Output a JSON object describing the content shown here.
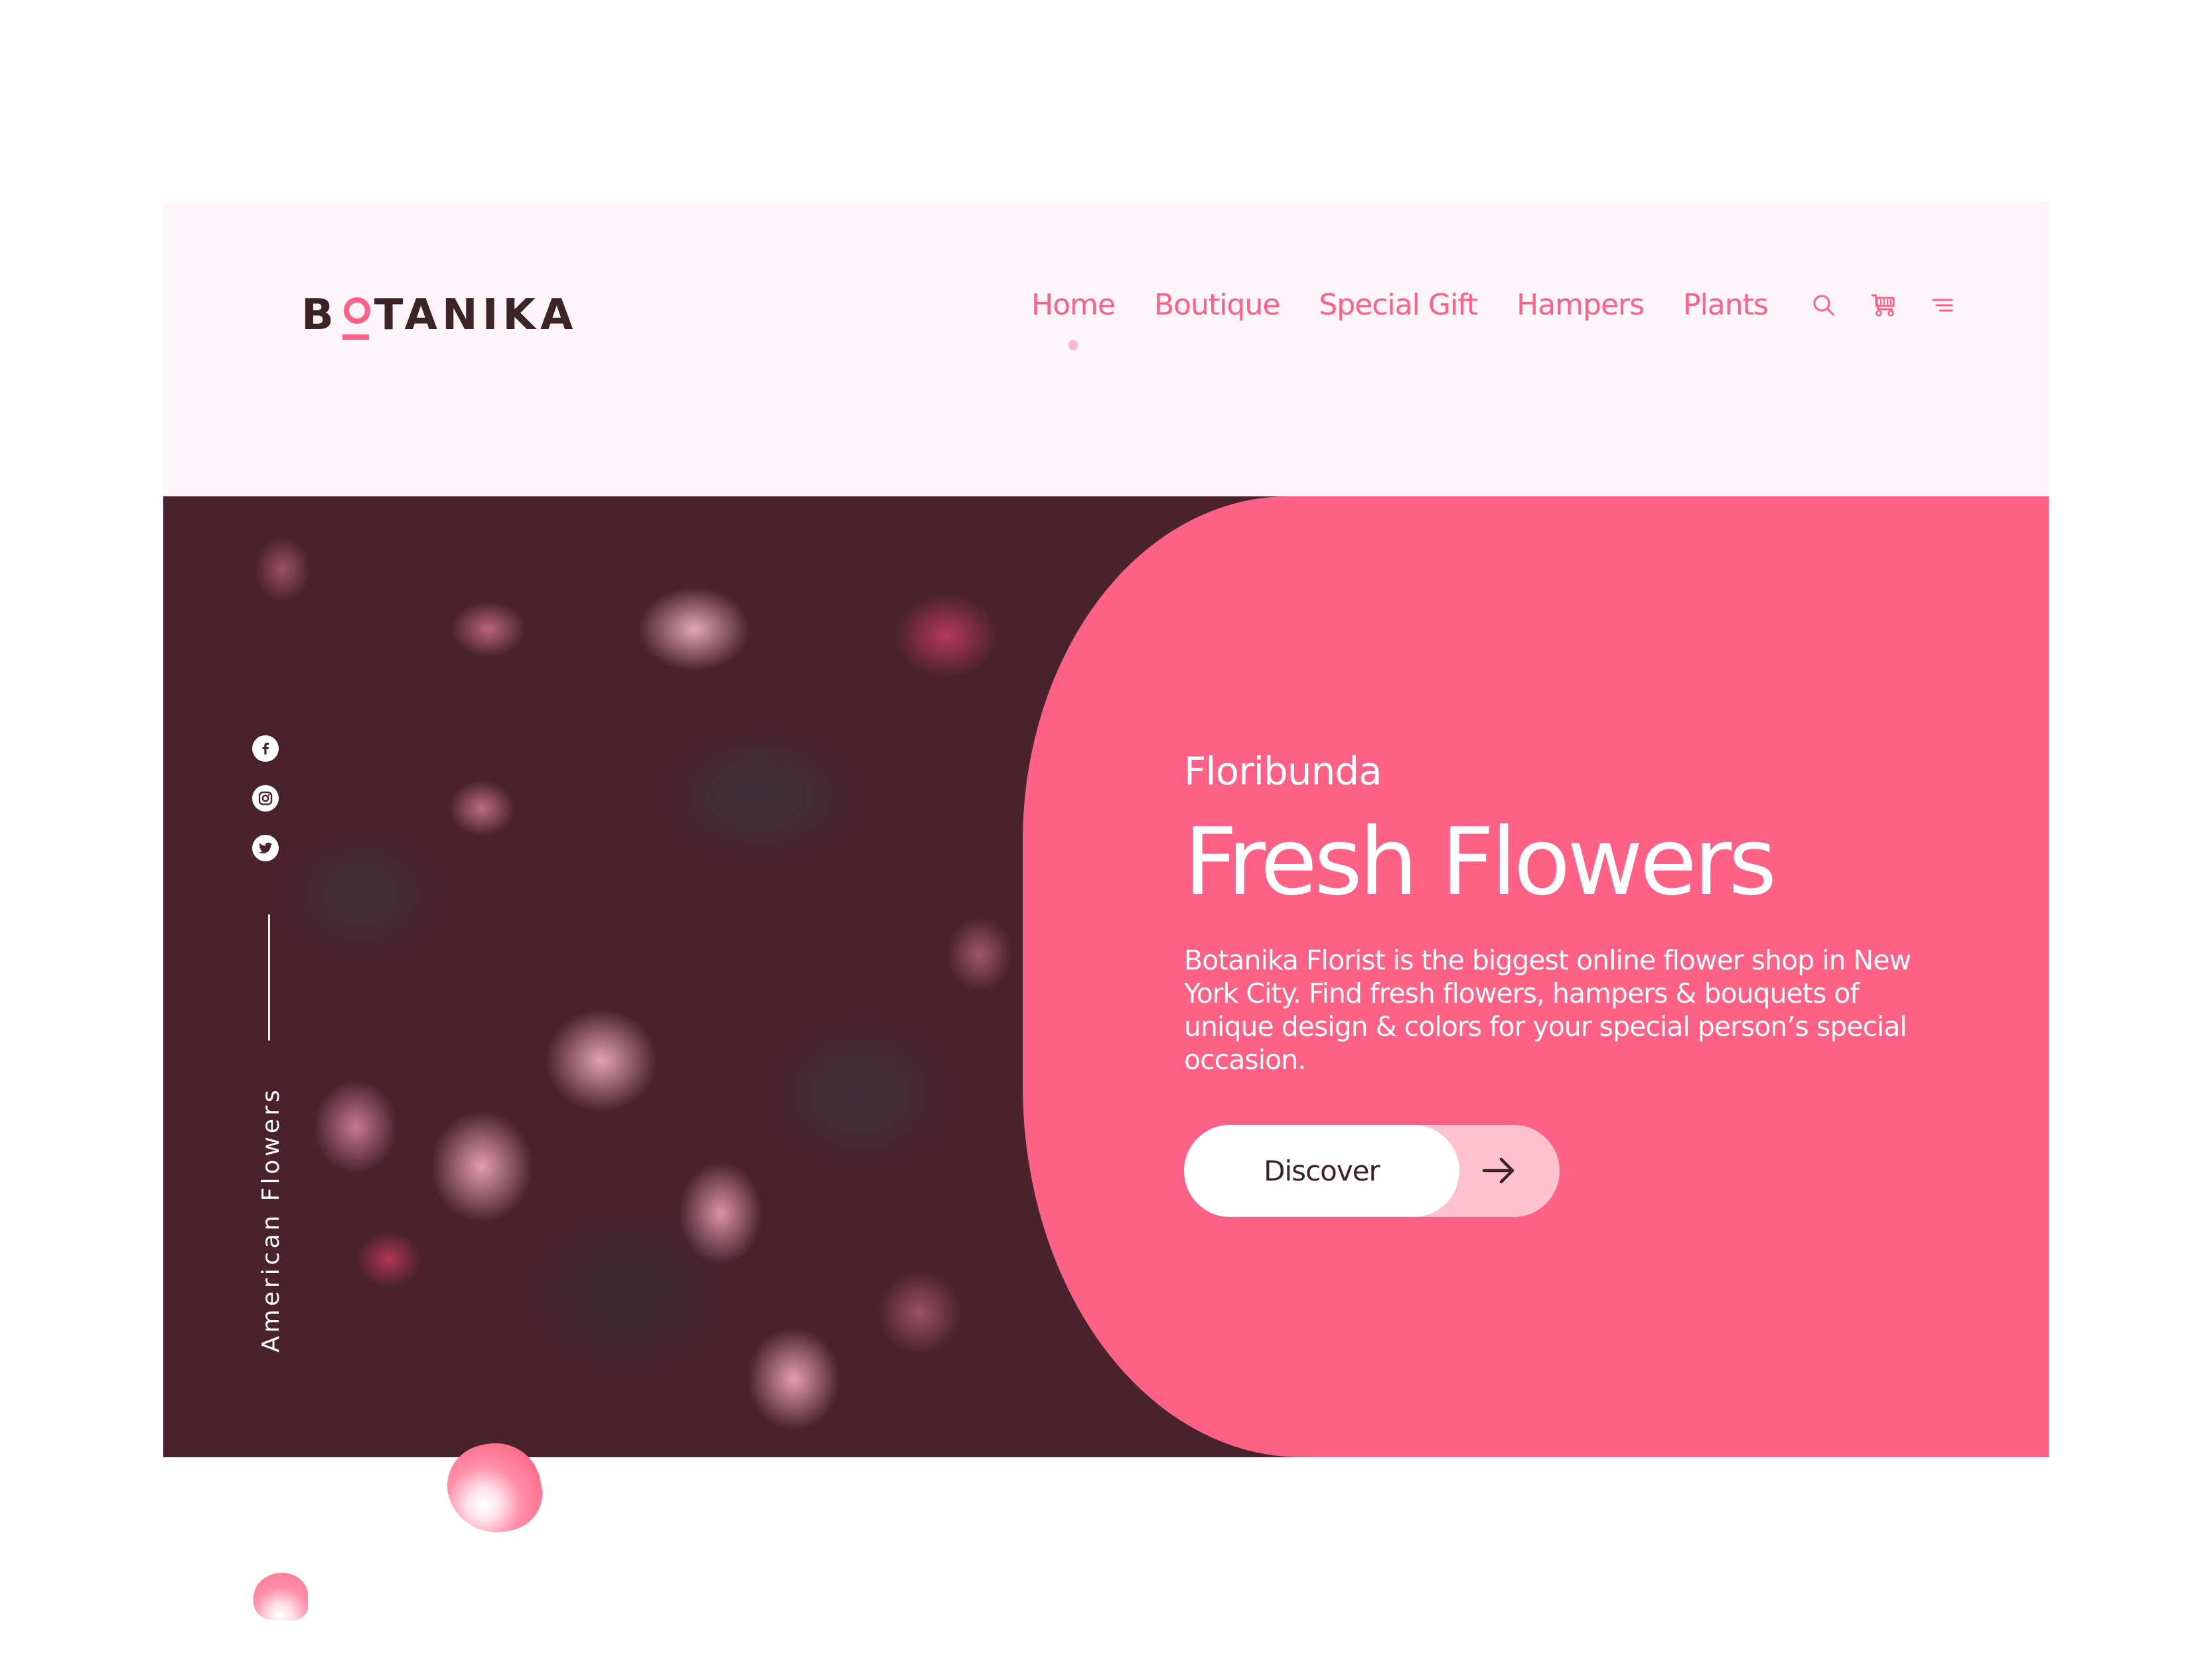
{
  "brand": {
    "logo_text_before": "B",
    "logo_text_after": "TANIKA",
    "accent_color": "#ff6186",
    "dark_color": "#3b2326"
  },
  "nav": {
    "items": [
      {
        "label": "Home",
        "active": true
      },
      {
        "label": "Boutique",
        "active": false
      },
      {
        "label": "Special Gift",
        "active": false
      },
      {
        "label": "Hampers",
        "active": false
      },
      {
        "label": "Plants",
        "active": false
      }
    ],
    "icons": [
      "search-icon",
      "cart-icon",
      "menu-icon"
    ]
  },
  "social": {
    "icons": [
      "facebook-icon",
      "instagram-icon",
      "twitter-icon"
    ]
  },
  "hero": {
    "side_label": "American Flowers",
    "subtitle": "Floribunda",
    "title": "Fresh Flowers",
    "description": "Botanika Florist is the biggest online flower shop in New York City. Find fresh flowers, hampers & bouquets of unique design & colors for your special person’s special occasion.",
    "cta_label": "Discover",
    "panel_color": "#ff6186",
    "image_description": "Dark moody photo of pink camellia flowers and leaves"
  },
  "slider": {
    "prev_icon": "chevron-left-icon",
    "next_icon": "chevron-right-icon"
  }
}
